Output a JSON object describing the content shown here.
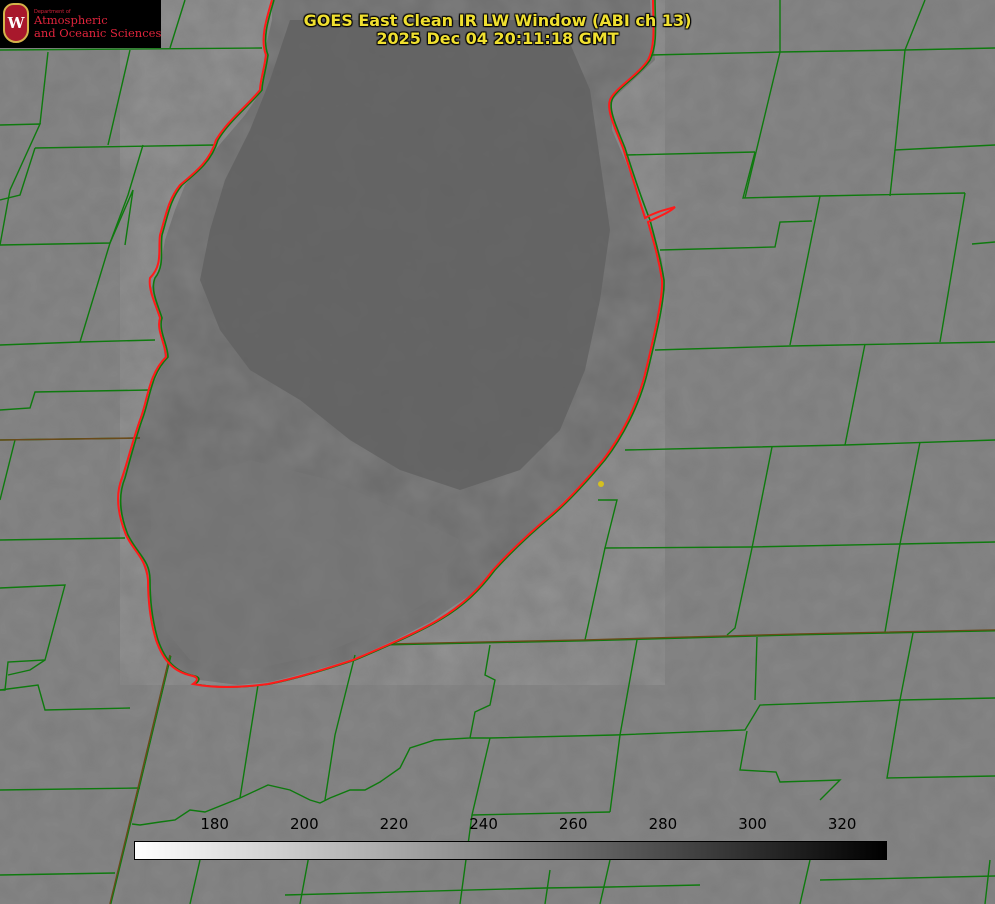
{
  "title": {
    "line1": "GOES East Clean IR LW Window (ABI ch 13)",
    "line2": "2025 Dec 04 20:11:18 GMT"
  },
  "logo": {
    "department": "Department of",
    "line1": "Atmospheric",
    "line2": "and Oceanic Sciences",
    "seal_letter": "W"
  },
  "colorbar": {
    "ticks": [
      "180",
      "200",
      "220",
      "240",
      "260",
      "280",
      "300",
      "320"
    ],
    "range": [
      162,
      330
    ],
    "gradient": [
      "#ffffff",
      "#000000"
    ]
  },
  "colors": {
    "land": "#7b7b7b",
    "lake_cloud": "#6a6a6a",
    "county_lines": "#0e7a0e",
    "shoreline": "#ff1a1a",
    "marker": "#d4c020",
    "title": "#f0e030"
  },
  "marker": {
    "name": "site-marker"
  }
}
